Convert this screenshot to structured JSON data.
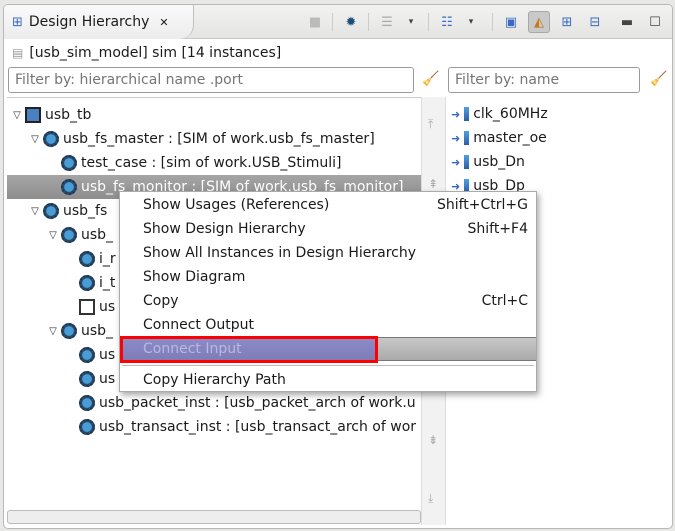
{
  "view": {
    "title": "Design Hierarchy",
    "close_icon": "close-icon"
  },
  "toolbar": [
    "stop-icon",
    "debug-icon",
    "list-menu-icon",
    "layout-menu-icon",
    "chip-icon",
    "sort-icon",
    "expand-all-icon",
    "collapse-all-icon",
    "minimize-icon",
    "maximize-icon"
  ],
  "info": {
    "text": "[usb_sim_model] sim [14 instances]"
  },
  "filters": {
    "hier_placeholder": "Filter by: hierarchical name .port",
    "name_placeholder": "Filter by: name"
  },
  "tree": [
    {
      "label": "usb_tb",
      "icon": "A"
    },
    {
      "label": "usb_fs_master : [SIM of work.usb_fs_master]",
      "icon": "E"
    },
    {
      "label": "test_case : [sim of work.USB_Stimuli]",
      "icon": "E"
    },
    {
      "label": "usb_fs_monitor : [SIM of work.usb_fs_monitor]",
      "icon": "E"
    },
    {
      "label": "usb_fs",
      "icon": "E"
    },
    {
      "label": "usb_",
      "icon": "E"
    },
    {
      "label": "i_r",
      "icon": "E"
    },
    {
      "label": "i_t",
      "icon": "E"
    },
    {
      "label": "us",
      "icon": "G"
    },
    {
      "label": "usb_",
      "icon": "E"
    },
    {
      "label": "us",
      "icon": "C"
    },
    {
      "label": "us",
      "icon": "C"
    },
    {
      "label": "usb_packet_inst : [usb_packet_arch of work.u",
      "icon": "C"
    },
    {
      "label": "usb_transact_inst : [usb_transact_arch of wor",
      "icon": "C"
    }
  ],
  "ports": [
    "clk_60MHz",
    "master_oe",
    "usb_Dn",
    "usb_Dp"
  ],
  "menu": [
    {
      "label": "Show Usages (References)",
      "shortcut": "Shift+Ctrl+G"
    },
    {
      "label": "Show Design Hierarchy",
      "shortcut": "Shift+F4"
    },
    {
      "label": "Show All Instances in Design Hierarchy",
      "shortcut": ""
    },
    {
      "label": "Show Diagram",
      "shortcut": ""
    },
    {
      "label": "Copy",
      "shortcut": "Ctrl+C"
    },
    {
      "label": "Connect Output",
      "shortcut": ""
    },
    {
      "label": "Connect Input",
      "shortcut": "",
      "state": "disabled-highlighted"
    },
    {
      "label": "Copy Hierarchy Path",
      "shortcut": ""
    }
  ],
  "colors": {
    "highlight": "#8d8bc8",
    "annotation": "#ff0000",
    "selection": "#999999"
  }
}
